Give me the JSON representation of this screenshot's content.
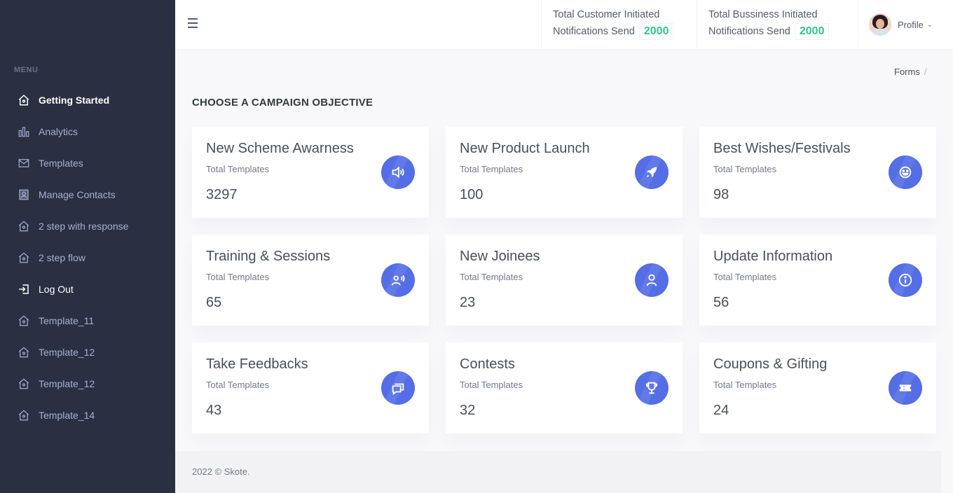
{
  "sidebar": {
    "menu_title": "MENU",
    "items": [
      {
        "label": "Getting Started",
        "icon": "home-icon"
      },
      {
        "label": "Analytics",
        "icon": "bar-chart-icon"
      },
      {
        "label": "Templates",
        "icon": "envelope-icon"
      },
      {
        "label": "Manage Contacts",
        "icon": "contact-book-icon"
      },
      {
        "label": "2 step with response",
        "icon": "home-icon"
      },
      {
        "label": "2 step flow",
        "icon": "home-icon"
      },
      {
        "label": "Log Out",
        "icon": "logout-icon"
      },
      {
        "label": "Template_11",
        "icon": "home-icon"
      },
      {
        "label": "Template_12",
        "icon": "home-icon"
      },
      {
        "label": "Template_12",
        "icon": "home-icon"
      },
      {
        "label": "Template_14",
        "icon": "home-icon"
      }
    ]
  },
  "header": {
    "notif1": {
      "line1": "Total Customer Initiated",
      "line2": "Notifications Send",
      "count": "2000"
    },
    "notif2": {
      "line1": "Total Bussiness Initiated",
      "line2": "Notifications Send",
      "count": "2000"
    },
    "profile_label": "Profile"
  },
  "breadcrumb": {
    "item": "Forms",
    "separator": "/"
  },
  "page_title": "CHOOSE A CAMPAIGN OBJECTIVE",
  "cards": [
    {
      "title": "New Scheme Awarness",
      "subtitle": "Total Templates",
      "value": "3297",
      "icon": "megaphone-icon"
    },
    {
      "title": "New Product Launch",
      "subtitle": "Total Templates",
      "value": "100",
      "icon": "rocket-icon"
    },
    {
      "title": "Best Wishes/Festivals",
      "subtitle": "Total Templates",
      "value": "98",
      "icon": "smiley-icon"
    },
    {
      "title": "Training & Sessions",
      "subtitle": "Total Templates",
      "value": "65",
      "icon": "user-voice-icon"
    },
    {
      "title": "New Joinees",
      "subtitle": "Total Templates",
      "value": "23",
      "icon": "user-icon"
    },
    {
      "title": "Update Information",
      "subtitle": "Total Templates",
      "value": "56",
      "icon": "info-icon"
    },
    {
      "title": "Take Feedbacks",
      "subtitle": "Total Templates",
      "value": "43",
      "icon": "chat-icon"
    },
    {
      "title": "Contests",
      "subtitle": "Total Templates",
      "value": "32",
      "icon": "trophy-icon"
    },
    {
      "title": "Coupons & Gifting",
      "subtitle": "Total Templates",
      "value": "24",
      "icon": "coupon-icon"
    }
  ],
  "footer": {
    "text": "2022 © Skote."
  },
  "colors": {
    "sidebar_bg": "#2a3042",
    "accent": "#556ee6",
    "count_green": "#34c38f"
  }
}
